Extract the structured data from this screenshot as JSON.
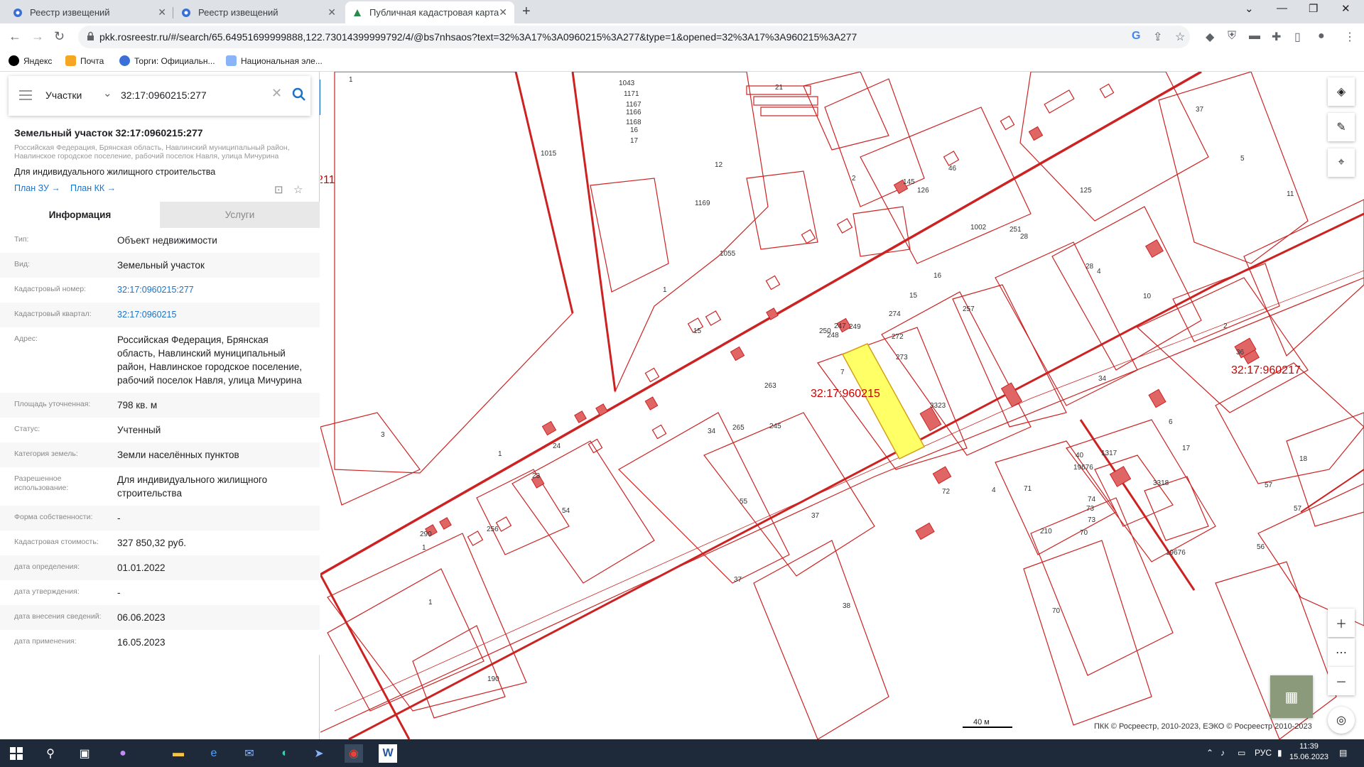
{
  "browser": {
    "tabs": [
      {
        "label": "Реестр извещений",
        "active": false
      },
      {
        "label": "Реестр извещений",
        "active": false
      },
      {
        "label": "Публичная кадастровая карта",
        "active": true
      }
    ],
    "url": "pkk.rosreestr.ru/#/search/65.64951699999888,122.73014399999792/4/@bs7nhsaos?text=32%3A17%3A0960215%3A277&type=1&opened=32%3A17%3A960215%3A277",
    "bookmarks": [
      "Яндекс",
      "Почта",
      "Торги: Официальн...",
      "Национальная эле..."
    ]
  },
  "search": {
    "type_label": "Участки",
    "value": "32:17:0960215:277"
  },
  "parcel": {
    "title": "Земельный участок 32:17:0960215:277",
    "address_small": "Российская Федерация, Брянская область, Навлинский муниципальный район, Навлинское городское поселение, рабочий поселок Навля, улица Мичурина",
    "use": "Для индивидуального жилищного строительства",
    "plan_zu": "План ЗУ →",
    "plan_kk": "План КК →"
  },
  "panel_tabs": {
    "info": "Информация",
    "services": "Услуги"
  },
  "rows": [
    {
      "k": "Тип:",
      "v": "Объект недвижимости",
      "link": false
    },
    {
      "k": "Вид:",
      "v": "Земельный участок",
      "link": false
    },
    {
      "k": "Кадастровый номер:",
      "v": "32:17:0960215:277",
      "link": true
    },
    {
      "k": "Кадастровый квартал:",
      "v": "32:17:0960215",
      "link": true
    },
    {
      "k": "Адрес:",
      "v": "Российская Федерация, Брянская область, Навлинский муниципальный район, Навлинское городское поселение, рабочий поселок Навля, улица Мичурина",
      "link": false
    },
    {
      "k": "Площадь уточненная:",
      "v": "798 кв. м",
      "link": false
    },
    {
      "k": "Статус:",
      "v": "Учтенный",
      "link": false
    },
    {
      "k": "Категория земель:",
      "v": "Земли населённых пунктов",
      "link": false
    },
    {
      "k": "Разрешенное использование:",
      "v": "Для индивидуального жилищного строительства",
      "link": false
    },
    {
      "k": "Форма собственности:",
      "v": "-",
      "link": false
    },
    {
      "k": "Кадастровая стоимость:",
      "v": "327 850,32 руб.",
      "link": false
    },
    {
      "k": "дата определения:",
      "v": "01.01.2022",
      "link": false
    },
    {
      "k": "дата утверждения:",
      "v": "-",
      "link": false
    },
    {
      "k": "дата внесения сведений:",
      "v": "06.06.2023",
      "link": false
    },
    {
      "k": "дата применения:",
      "v": "16.05.2023",
      "link": false
    }
  ],
  "map": {
    "quarter_label_main": "32:17:960215",
    "quarter_label_right": "32:17:960217",
    "quarter_label_left": "211",
    "scale": "40 м",
    "attribution": "ПКК © Росреестр, 2010-2023, ЕЭКО © Росреестр 2010-2023",
    "labels": [
      "1",
      "1015",
      "1043",
      "1171",
      "1167",
      "1166",
      "1168",
      "16",
      "17",
      "12",
      "1169",
      "1055",
      "1",
      "15",
      "21",
      "2",
      "37",
      "5",
      "11",
      "1002",
      "28",
      "28",
      "16",
      "15",
      "274",
      "272",
      "273",
      "7",
      "4",
      "10",
      "2",
      "6",
      "17",
      "18",
      "57",
      "57",
      "56",
      "3",
      "1",
      "23",
      "24",
      "54",
      "55",
      "37",
      "37",
      "4",
      "72",
      "71",
      "74",
      "73",
      "73",
      "210",
      "70",
      "70",
      "1",
      "1",
      "190",
      "38",
      "145",
      "126",
      "46",
      "125",
      "251",
      "257",
      "263",
      "245",
      "250",
      "249",
      "248",
      "247",
      "265",
      "34",
      "290",
      "256",
      "3323",
      "3318",
      "34",
      "36",
      "40",
      "1317",
      "19676",
      "19676",
      "38"
    ]
  },
  "taskbar": {
    "lang": "РУС",
    "time": "11:39",
    "date": "15.06.2023"
  },
  "colors": {
    "accent": "#1a73c8",
    "parcel_line": "#cc0000",
    "selected_fill": "#ffff66"
  }
}
